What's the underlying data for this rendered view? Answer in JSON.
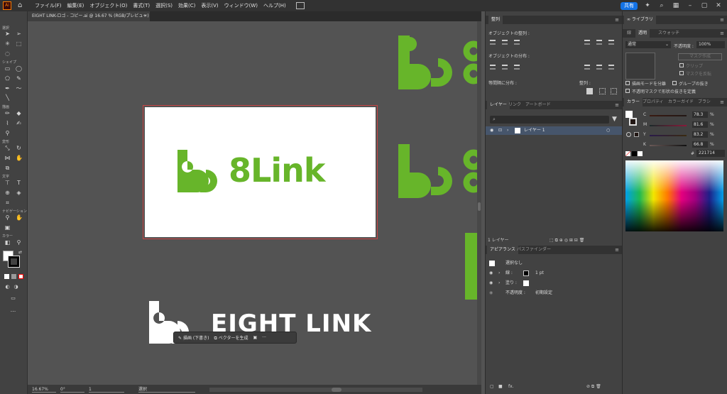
{
  "app": {
    "logo": "Ai",
    "menus": [
      "ファイル(F)",
      "編集(E)",
      "オブジェクト(O)",
      "書式(T)",
      "選択(S)",
      "効果(C)",
      "表示(V)",
      "ウィンドウ(W)",
      "ヘルプ(H)"
    ],
    "share_label": "共有"
  },
  "document": {
    "tab_title": "EIGHT LINK-ロゴ - コピー.ai @ 16.67 % (RGB/プレビュー)",
    "close": "×"
  },
  "toolbar": {
    "sections": [
      "選択",
      "シェイプ",
      "描画",
      "変形",
      "文字",
      "ナビゲーション",
      "カラー"
    ],
    "more": "..."
  },
  "canvas": {
    "artboard_logo_text": "8Link",
    "bottom_logo_text": "EIGHT LINK",
    "context_bar": {
      "sketch_label": "描画 (下書き)",
      "vector_label": "ベクターを生成",
      "more": "···"
    }
  },
  "status": {
    "zoom": "16.67%",
    "rotate": "0°",
    "artboard_num": "1",
    "mode": "選択"
  },
  "align_panel": {
    "tab": "整列",
    "align_objects": "オブジェクトの整列 :",
    "distribute_objects": "オブジェクトの分布 :",
    "distribute_spacing": "等間隔に分布 :",
    "align_to": "整列 :"
  },
  "layers_panel": {
    "tabs": [
      "レイヤー",
      "リンク",
      "アートボード"
    ],
    "layer_name": "レイヤー 1",
    "footer": "1 レイヤー"
  },
  "appearance_panel": {
    "tabs": [
      "アピアランス",
      "パスファインダー"
    ],
    "no_selection": "選択なし",
    "stroke_label": "線 :",
    "stroke_value": "1 pt",
    "fill_label": "塗り :",
    "opacity_label": "不透明度 :",
    "opacity_value": "初期設定",
    "fx": "fx."
  },
  "library": {
    "title": "ライブラリ"
  },
  "transparency_panel": {
    "tabs": [
      "線",
      "透明",
      "スウォッチ"
    ],
    "blend_mode": "通常",
    "opacity_label": "不透明度 :",
    "opacity_value": "100%",
    "make_mask": "マスク作成",
    "clip": "クリップ",
    "invert_mask": "マスクを反転",
    "isolate_blend": "描画モードを分離",
    "knockout_group": "グループの抜き",
    "opacity_shape": "不透明マスクで形状の抜きを定義"
  },
  "color_panel": {
    "tabs": [
      "カラー",
      "プロパティ",
      "カラーガイド",
      "ブラシ"
    ],
    "channels": [
      {
        "name": "C",
        "value": "78.3",
        "unit": "%"
      },
      {
        "name": "M",
        "value": "81.6",
        "unit": "%"
      },
      {
        "name": "Y",
        "value": "83.2",
        "unit": "%"
      },
      {
        "name": "K",
        "value": "66.8",
        "unit": "%"
      }
    ],
    "hex": "221714",
    "hash": "#"
  },
  "colors": {
    "brand_green": "#67b52a",
    "accent_blue": "#1473e6",
    "selection_red": "#c94444"
  }
}
